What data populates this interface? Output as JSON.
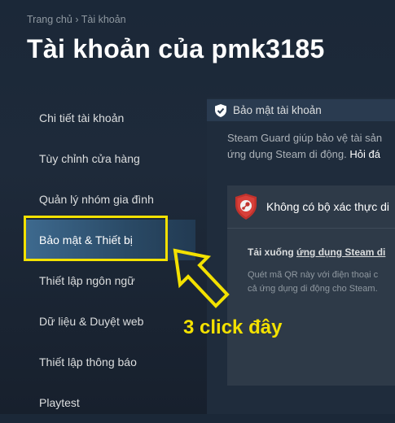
{
  "breadcrumb": {
    "home": "Trang chủ",
    "separator": "›",
    "current": "Tài khoản"
  },
  "page_title": "Tài khoản của pmk3185",
  "sidebar": {
    "items": [
      {
        "label": "Chi tiết tài khoản"
      },
      {
        "label": "Tùy chỉnh cửa hàng"
      },
      {
        "label": "Quản lý nhóm gia đình"
      },
      {
        "label": "Bảo mật & Thiết bị"
      },
      {
        "label": "Thiết lập ngôn ngữ"
      },
      {
        "label": "Dữ liệu & Duyệt web"
      },
      {
        "label": "Thiết lập thông báo"
      },
      {
        "label": "Playtest"
      }
    ],
    "active_index": 3
  },
  "main": {
    "section_title": "Bảo mật tài khoản",
    "section_icon": "shield-icon",
    "description_line1": "Steam Guard giúp bảo vệ tài sản",
    "description_line2": "ứng dụng Steam di động.",
    "description_link": "Hỏi đá",
    "card": {
      "icon": "steam-shield-icon",
      "title": "Không có bộ xác thực di",
      "download_prefix": "Tải xuống",
      "download_link": "ứng dụng Steam di",
      "qr_line1": "Quét mã QR này với điện thoại c",
      "qr_line2": "cả ứng dụng di động cho Steam."
    }
  },
  "annotation": {
    "text": "3 click đây",
    "color": "#f3e100"
  },
  "colors": {
    "background": "#1b2838",
    "active_item": "#3e6a8f",
    "annotation_yellow": "#f3e100"
  }
}
